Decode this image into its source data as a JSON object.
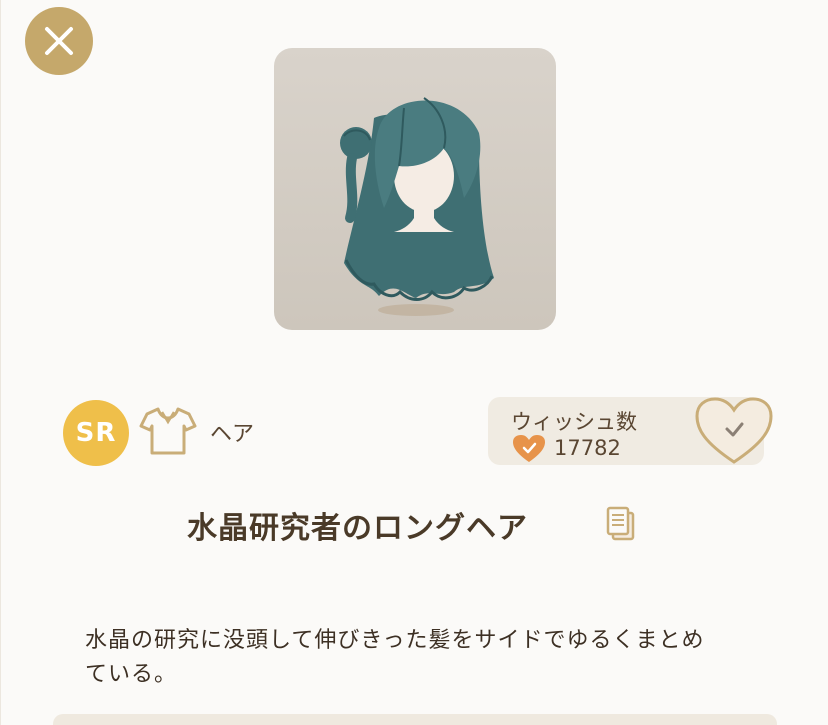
{
  "close": {
    "icon": "close-icon"
  },
  "item": {
    "name": "水晶研究者のロングヘア",
    "rarity": "SR",
    "category": "ヘア",
    "category_icon": "shirt-icon",
    "description": "水晶の研究に没頭して伸びきった髪をサイドでゆるくまとめている。"
  },
  "wishlist": {
    "label": "ウィッシュ数",
    "count": "17782",
    "count_icon": "heart-check-icon",
    "button_icon": "heart-check-outline-icon"
  },
  "colors": {
    "accent": "#c5a86b",
    "rarity_badge": "#efbf4a",
    "heart_orange": "#e7934a",
    "hair": "#3f6f73",
    "text": "#4a3a28"
  }
}
